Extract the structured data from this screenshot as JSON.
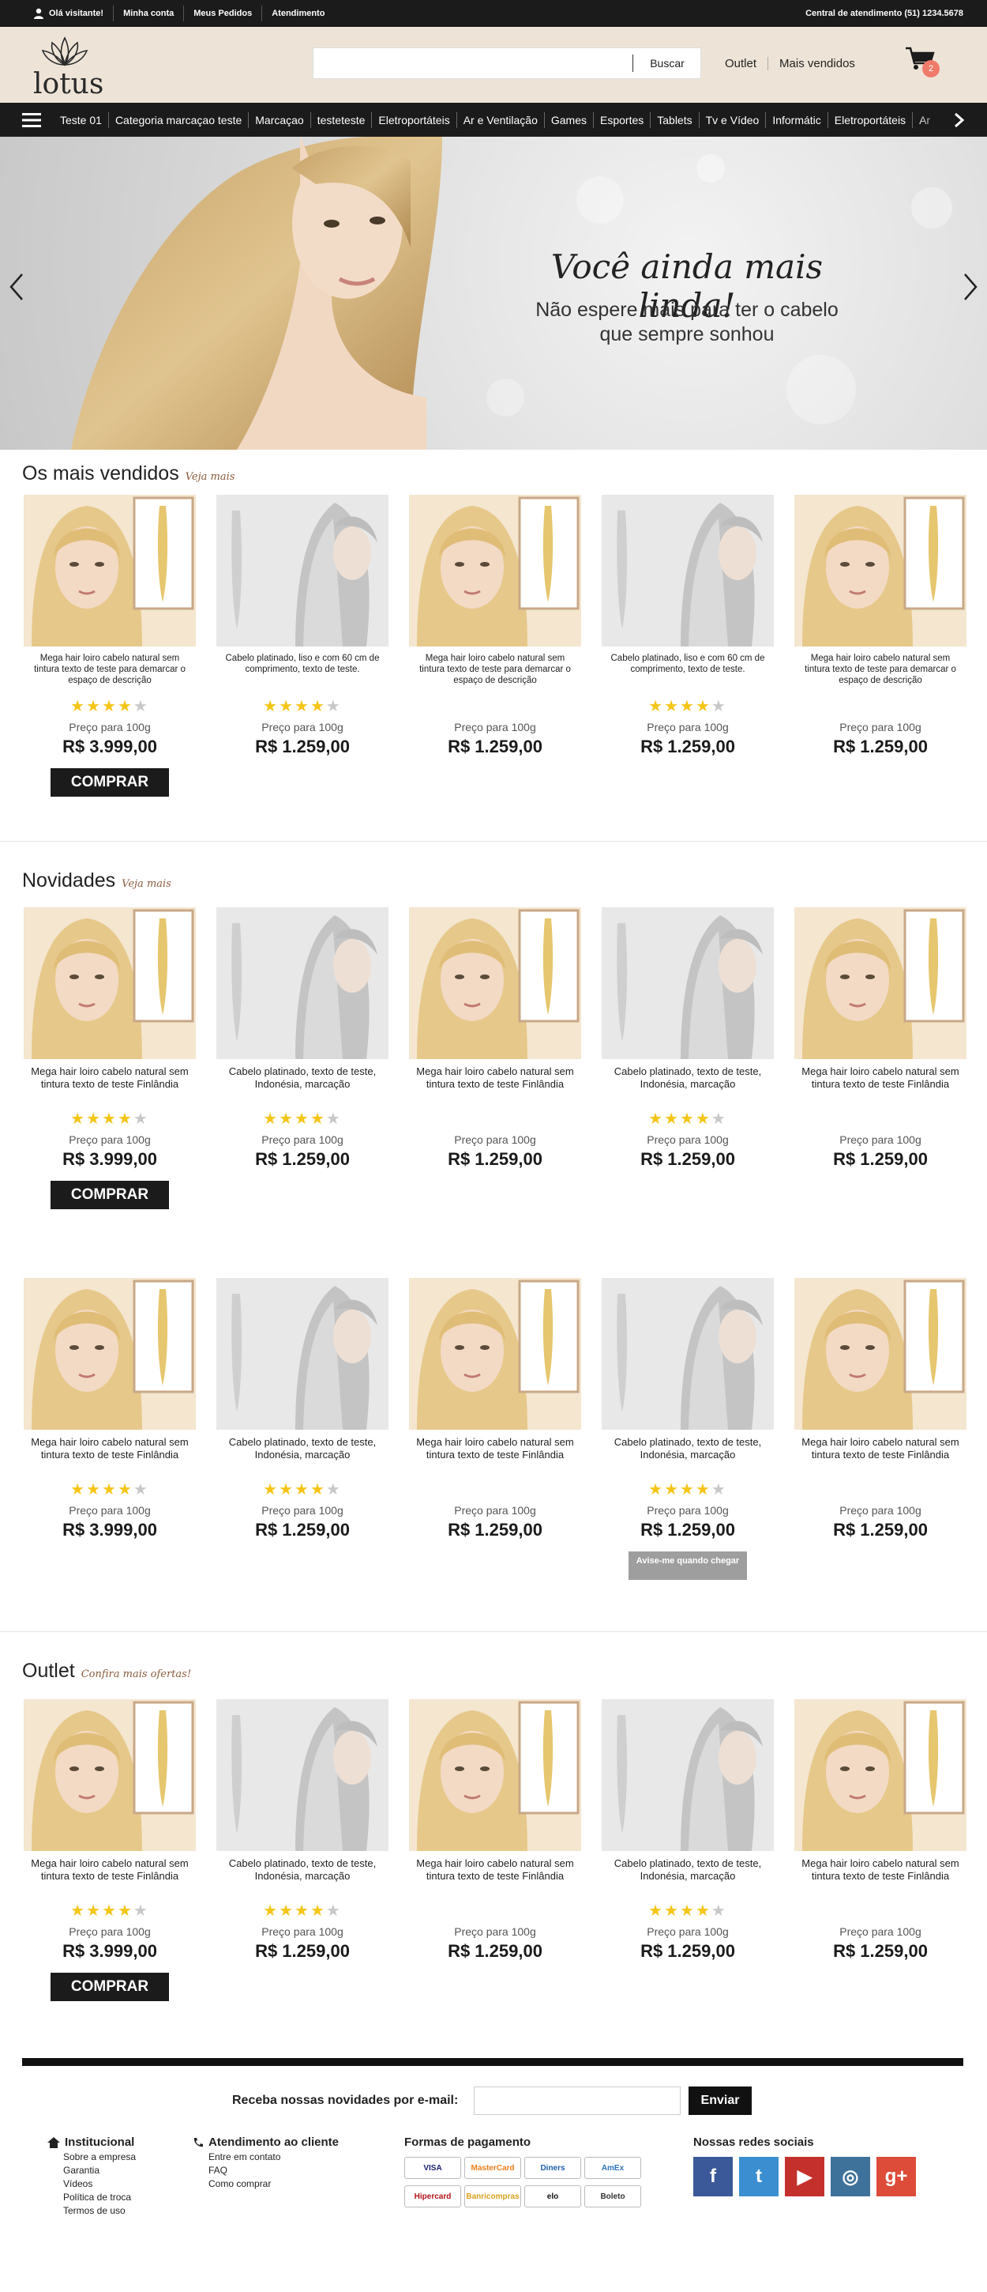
{
  "topbar": {
    "visitor": "Olá visitante!",
    "my_account": "Minha conta",
    "my_orders": "Meus Pedidos",
    "support": "Atendimento",
    "phone": "Central de atendimento (51) 1234.5678"
  },
  "header": {
    "logo_text": "lotus",
    "search_placeholder": "",
    "search_button": "Buscar",
    "outlet": "Outlet",
    "best_sellers": "Mais vendidos",
    "cart_count": "2"
  },
  "nav": {
    "items": [
      "Teste 01",
      "Categoria marcaçao teste",
      "Marcaçao",
      "testeteste",
      "Eletroportáteis",
      "Ar e Ventilação",
      "Games",
      "Esportes",
      "Tablets",
      "Tv e Vídeo",
      "Informátic",
      "Eletroportáteis",
      "Ar"
    ]
  },
  "hero": {
    "title": "Você ainda mais linda!",
    "subtitle_line1": "Não espere mais para ter o cabelo",
    "subtitle_line2": "que sempre sonhou"
  },
  "sections": {
    "best_sellers": {
      "title": "Os mais vendidos",
      "link": "Veja mais"
    },
    "news": {
      "title": "Novidades",
      "link": "Veja mais"
    },
    "outlet": {
      "title": "Outlet",
      "link": "Confira mais ofertas!"
    }
  },
  "products_best": [
    {
      "name": "Mega hair loiro cabelo natural sem tintura texto de teste para demarcar o espaço de descrição",
      "rating": 4,
      "label": "Preço para 100g",
      "price": "R$ 3.999,00",
      "buy": "COMPRAR",
      "kind": "blonde"
    },
    {
      "name": "Cabelo platinado, liso e com 60 cm de comprimento, texto de teste.",
      "rating": 4,
      "label": "Preço para 100g",
      "price": "R$ 1.259,00",
      "kind": "silver"
    },
    {
      "name": "Mega hair loiro cabelo natural sem tintura texto de teste para demarcar o espaço de descrição",
      "rating": 0,
      "label": "Preço para 100g",
      "price": "R$ 1.259,00",
      "kind": "blonde"
    },
    {
      "name": "Cabelo platinado, liso e com 60 cm de comprimento, texto de teste.",
      "rating": 4,
      "label": "Preço para 100g",
      "price": "R$ 1.259,00",
      "kind": "silver"
    },
    {
      "name": "Mega hair loiro cabelo natural sem tintura texto de teste para demarcar o espaço de descrição",
      "rating": 0,
      "label": "Preço para 100g",
      "price": "R$ 1.259,00",
      "kind": "blonde"
    }
  ],
  "products_news_1": [
    {
      "name": "Mega hair loiro cabelo natural sem tintura texto de teste Finlândia",
      "rating": 4,
      "label": "Preço para 100g",
      "price": "R$ 3.999,00",
      "buy": "COMPRAR",
      "kind": "blonde"
    },
    {
      "name": "Cabelo platinado, texto de teste, Indonésia, marcação",
      "rating": 4,
      "label": "Preço para 100g",
      "price": "R$ 1.259,00",
      "kind": "silver"
    },
    {
      "name": "Mega hair loiro cabelo natural sem tintura texto de teste Finlândia",
      "rating": 0,
      "label": "Preço para 100g",
      "price": "R$ 1.259,00",
      "kind": "blonde"
    },
    {
      "name": "Cabelo platinado, texto de teste, Indonésia, marcação",
      "rating": 4,
      "label": "Preço para 100g",
      "price": "R$ 1.259,00",
      "kind": "silver"
    },
    {
      "name": "Mega hair loiro cabelo natural sem tintura texto de teste Finlândia",
      "rating": 0,
      "label": "Preço para 100g",
      "price": "R$ 1.259,00",
      "kind": "blonde"
    }
  ],
  "products_news_2": [
    {
      "name": "Mega hair loiro cabelo natural sem tintura texto de teste Finlândia",
      "rating": 4,
      "label": "Preço para 100g",
      "price": "R$ 3.999,00",
      "kind": "blonde"
    },
    {
      "name": "Cabelo platinado, texto de teste, Indonésia, marcação",
      "rating": 4,
      "label": "Preço para 100g",
      "price": "R$ 1.259,00",
      "kind": "silver"
    },
    {
      "name": "Mega hair loiro cabelo natural sem tintura texto de teste Finlândia",
      "rating": 0,
      "label": "Preço para 100g",
      "price": "R$ 1.259,00",
      "kind": "blonde"
    },
    {
      "name": "Cabelo platinado, texto de teste, Indonésia, marcação",
      "rating": 4,
      "label": "Preço para 100g",
      "price": "R$ 1.259,00",
      "notify": "Avise-me quando chegar",
      "kind": "silver"
    },
    {
      "name": "Mega hair loiro cabelo natural sem tintura texto de teste Finlândia",
      "rating": 0,
      "label": "Preço para 100g",
      "price": "R$ 1.259,00",
      "kind": "blonde"
    }
  ],
  "products_outlet": [
    {
      "name": "Mega hair loiro cabelo natural sem tintura texto de teste Finlândia",
      "rating": 4,
      "label": "Preço para 100g",
      "price": "R$ 3.999,00",
      "buy": "COMPRAR",
      "kind": "blonde"
    },
    {
      "name": "Cabelo platinado, texto de teste, Indonésia, marcação",
      "rating": 4,
      "label": "Preço para 100g",
      "price": "R$ 1.259,00",
      "kind": "silver"
    },
    {
      "name": "Mega hair loiro cabelo natural sem tintura texto de teste Finlândia",
      "rating": 0,
      "label": "Preço para 100g",
      "price": "R$ 1.259,00",
      "kind": "blonde"
    },
    {
      "name": "Cabelo platinado, texto de teste, Indonésia, marcação",
      "rating": 4,
      "label": "Preço para 100g",
      "price": "R$ 1.259,00",
      "kind": "silver"
    },
    {
      "name": "Mega hair loiro cabelo natural sem tintura texto de teste Finlândia",
      "rating": 0,
      "label": "Preço para 100g",
      "price": "R$ 1.259,00",
      "kind": "blonde"
    }
  ],
  "footer": {
    "newsletter_label": "Receba nossas novidades por e-mail:",
    "newsletter_button": "Enviar",
    "institucional": {
      "title": "Institucional",
      "links": [
        "Sobre a empresa",
        "Garantia",
        "Vídeos",
        "Política de troca",
        "Termos de uso"
      ]
    },
    "atendimento": {
      "title": "Atendimento ao cliente",
      "links": [
        "Entre em contato",
        "FAQ",
        "Como comprar"
      ]
    },
    "payment": {
      "title": "Formas de pagamento",
      "methods": [
        "VISA",
        "MasterCard",
        "Diners",
        "AmEx",
        "Hipercard",
        "Banricompras",
        "elo",
        "Boleto"
      ]
    },
    "social": {
      "title": "Nossas redes sociais",
      "networks": [
        "facebook",
        "twitter",
        "youtube",
        "instagram",
        "google-plus"
      ]
    }
  },
  "colors": {
    "dark": "#1b1b1b",
    "beige": "#ede4d7",
    "star": "#f5c518",
    "link_brown": "#8b5a3c",
    "badge": "#f07a6a"
  }
}
